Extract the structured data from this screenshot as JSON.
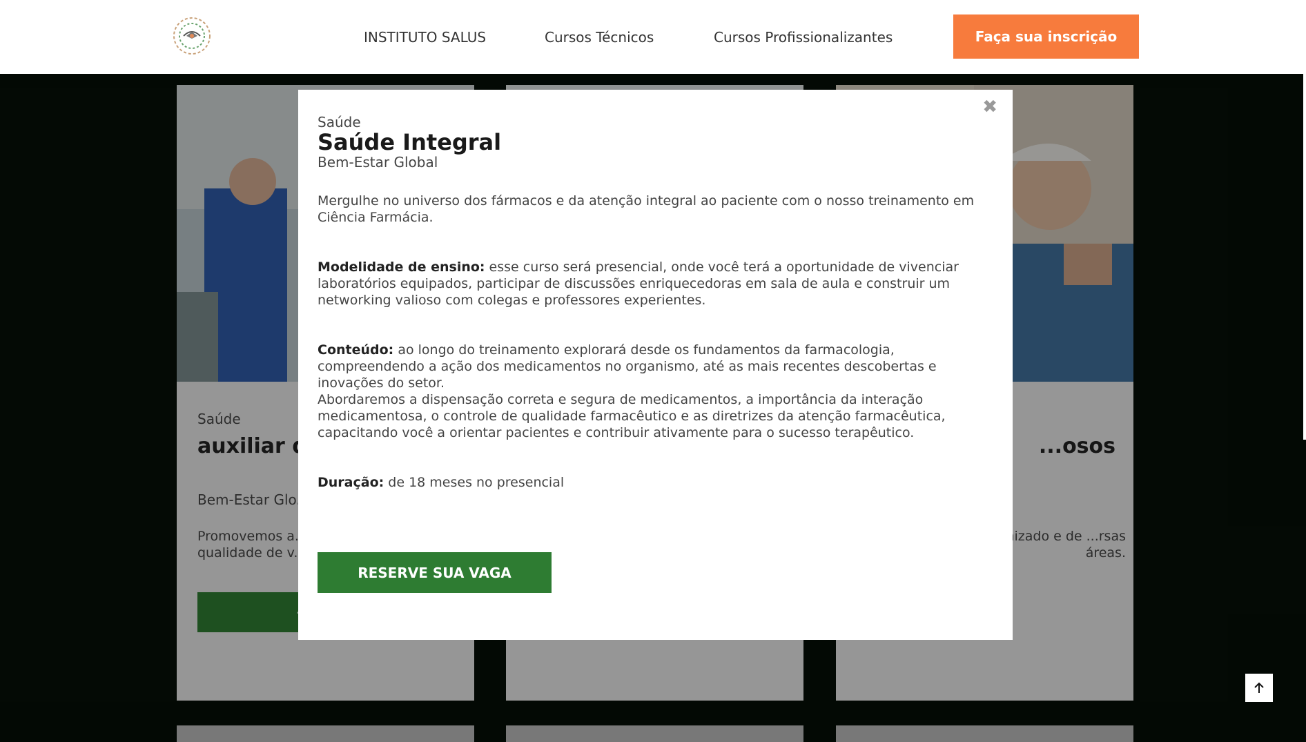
{
  "header": {
    "logo_icon": "institute-logo-icon",
    "nav": [
      "INSTITUTO SALUS",
      "Cursos Técnicos",
      "Cursos Profissionalizantes"
    ],
    "cta": "Faça sua inscrição"
  },
  "cards": [
    {
      "category": "Saúde",
      "title": "auxiliar de ... clinicas",
      "subtitle": "Bem-Estar Glo...",
      "description": "Promovemos a... dimensões, co... qualidade de v...",
      "button": "+INF..."
    },
    {
      "category": "",
      "title": "",
      "subtitle": "",
      "description": "",
      "button": ""
    },
    {
      "category": "",
      "title": "...osos",
      "subtitle": "",
      "description": "...n ...ilidades para ...anizado e de ...rsas áreas.",
      "button": ""
    }
  ],
  "modal": {
    "category": "Saúde",
    "title": "Saúde Integral",
    "subtitle": "Bem-Estar Global",
    "intro": "Mergulhe no universo dos fármacos e da atenção integral ao paciente com o nosso treinamento em Ciência Farmácia.",
    "modality_label": "Modelidade de ensino:",
    "modality_text": " esse curso será presencial, onde você terá a oportunidade de vivenciar laboratórios equipados, participar de discussões enriquecedoras em sala de aula e construir um networking valioso com colegas e professores experientes.",
    "content_label": "Conteúdo:",
    "content_text": " ao longo do treinamento explorará desde os fundamentos da farmacologia, compreendendo a ação dos medicamentos no organismo, até as mais recentes descobertas e inovações do setor.",
    "content_text_2": "Abordaremos a dispensação correta e segura de medicamentos, a importância da interação medicamentosa, o controle de qualidade farmacêutico e as diretrizes da atenção farmacêutica, capacitando você a orientar pacientes e contribuir ativamente para o sucesso terapêutico.",
    "duration_label": "Duração:",
    "duration_text": " de 18 meses no presencial",
    "button": "RESERVE SUA VAGA",
    "close_icon": "close-icon"
  },
  "back_to_top_icon": "arrow-up-icon",
  "colors": {
    "accent_orange": "#f77b3d",
    "accent_green": "#2e7c32",
    "page_dark": "#060f07"
  }
}
